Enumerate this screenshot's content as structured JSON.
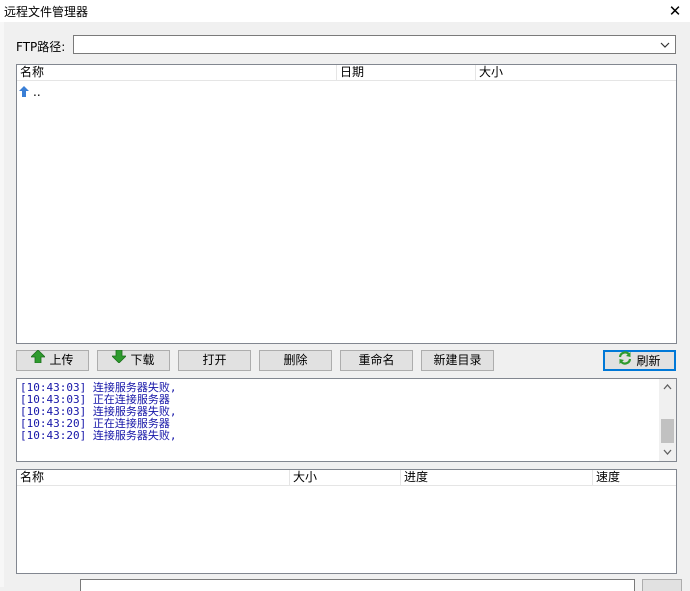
{
  "window": {
    "title": "远程文件管理器",
    "close_glyph": "✕"
  },
  "ftp": {
    "label": "FTP路径:",
    "value": "",
    "arrow_glyph": "⌵"
  },
  "file_list": {
    "columns": [
      "名称",
      "日期",
      "大小"
    ],
    "rows": [
      {
        "name": ".."
      }
    ]
  },
  "toolbar": {
    "upload": "上传",
    "download": "下载",
    "open": "打开",
    "delete": "删除",
    "rename": "重命名",
    "new_folder": "新建目录",
    "refresh": "刷新"
  },
  "log": {
    "lines": [
      "[10:43:03] 连接服务器失败,",
      "[10:43:03] 正在连接服务器",
      "[10:43:03] 连接服务器失败,",
      "[10:43:20] 正在连接服务器",
      "[10:43:20] 连接服务器失败,"
    ],
    "color": "#1515a8"
  },
  "transfer_list": {
    "columns": [
      "名称",
      "大小",
      "进度",
      "速度"
    ]
  },
  "icons": {
    "upload": "green-up-arrow-icon",
    "download": "green-down-arrow-icon",
    "refresh": "green-refresh-icon",
    "parent": "blue-up-arrow-icon"
  }
}
